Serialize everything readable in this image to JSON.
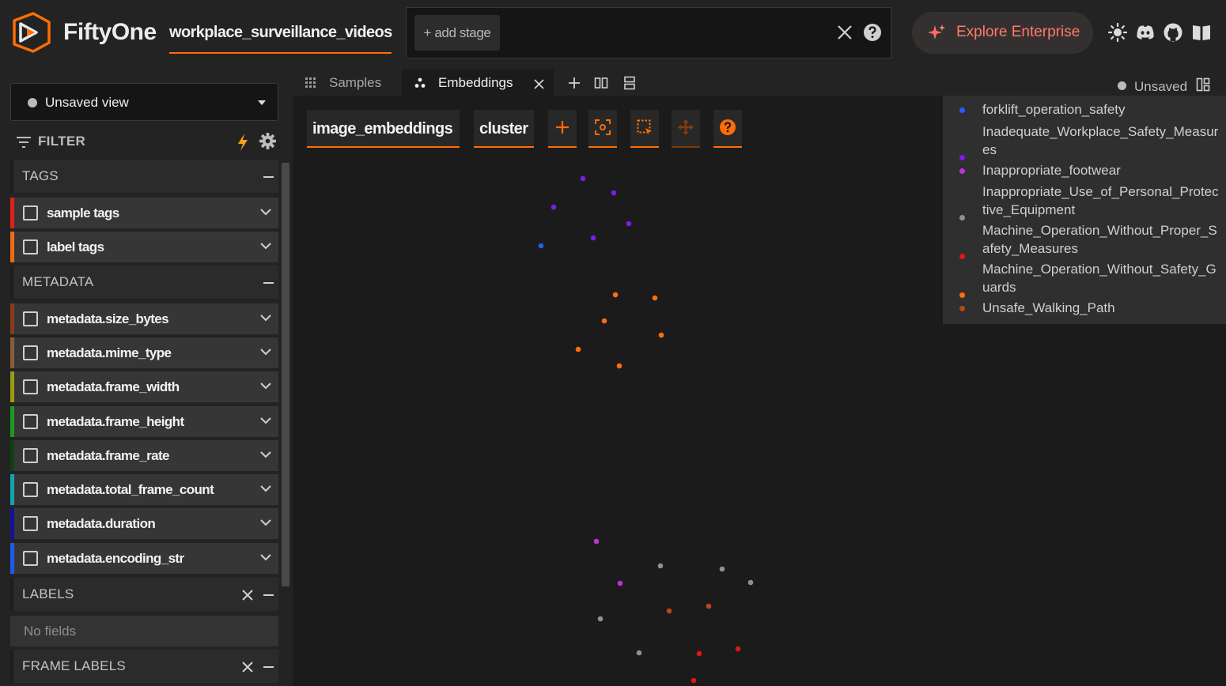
{
  "header": {
    "brand": "FiftyOne",
    "dataset_name": "workplace_surveillance_videos",
    "add_stage_label": "+ add stage",
    "enterprise_label": "Explore Enterprise"
  },
  "sidebar": {
    "view_selector_label": "Unsaved view",
    "filter_label": "FILTER",
    "groups": {
      "tags": "TAGS",
      "metadata": "METADATA",
      "labels": "LABELS",
      "frame_labels": "FRAME LABELS"
    },
    "tag_fields": [
      {
        "label": "sample tags",
        "color": "#e0201d"
      },
      {
        "label": "label tags",
        "color": "#ee6c13"
      }
    ],
    "metadata_fields": [
      {
        "label": "metadata.size_bytes",
        "color": "#8a3a1c"
      },
      {
        "label": "metadata.mime_type",
        "color": "#8a5d3a"
      },
      {
        "label": "metadata.frame_width",
        "color": "#9c9a10"
      },
      {
        "label": "metadata.frame_height",
        "color": "#1c9a1f"
      },
      {
        "label": "metadata.frame_rate",
        "color": "#123f12"
      },
      {
        "label": "metadata.total_frame_count",
        "color": "#13a6b0"
      },
      {
        "label": "metadata.duration",
        "color": "#12129a"
      },
      {
        "label": "metadata.encoding_str",
        "color": "#1a5cea"
      }
    ],
    "labels_empty_text": "No fields"
  },
  "tabs": {
    "samples_label": "Samples",
    "embeddings_label": "Embeddings",
    "unsaved_label": "Unsaved"
  },
  "embeddings": {
    "brain_key": "image_embeddings",
    "color_by": "cluster"
  },
  "colors": {
    "accent": "#ff6d04",
    "background": "#1b1b1b",
    "panel": "#232323"
  },
  "chart_data": {
    "type": "scatter",
    "series": [
      {
        "name": "forklift_operation_safety",
        "color": "#2060ff",
        "points": [
          [
            314,
            190
          ]
        ]
      },
      {
        "name": "Inadequate_Workplace_Safety_Measures",
        "color": "#7a1de6",
        "points": [
          [
            367,
            105
          ],
          [
            406,
            123
          ],
          [
            330,
            141
          ],
          [
            425,
            162
          ],
          [
            380,
            180
          ]
        ]
      },
      {
        "name": "Inappropriate_footwear",
        "color": "#c030d8",
        "points": [
          [
            384,
            564
          ],
          [
            414,
            617
          ]
        ]
      },
      {
        "name": "Inappropriate_Use_of_Personal_Protective_Equipment",
        "color": "#8a909e",
        "points": [
          [
            465,
            595
          ],
          [
            543,
            599
          ],
          [
            579,
            616
          ],
          [
            389,
            662
          ],
          [
            438,
            705
          ]
        ]
      },
      {
        "name": "Machine_Operation_Without_Proper_Safety_Measures",
        "color": "#e01515",
        "points": [
          [
            514,
            706
          ],
          [
            563,
            700
          ],
          [
            507,
            740
          ]
        ]
      },
      {
        "name": "Machine_Operation_Without_Safety_Guards",
        "color": "#ff6d10",
        "points": [
          [
            408,
            252
          ],
          [
            458,
            256
          ],
          [
            394,
            285
          ],
          [
            466,
            303
          ],
          [
            361,
            321
          ],
          [
            413,
            342
          ]
        ]
      },
      {
        "name": "Unsafe_Walking_Path",
        "color": "#b8471a",
        "points": [
          [
            476,
            652
          ],
          [
            526,
            646
          ]
        ]
      }
    ]
  }
}
